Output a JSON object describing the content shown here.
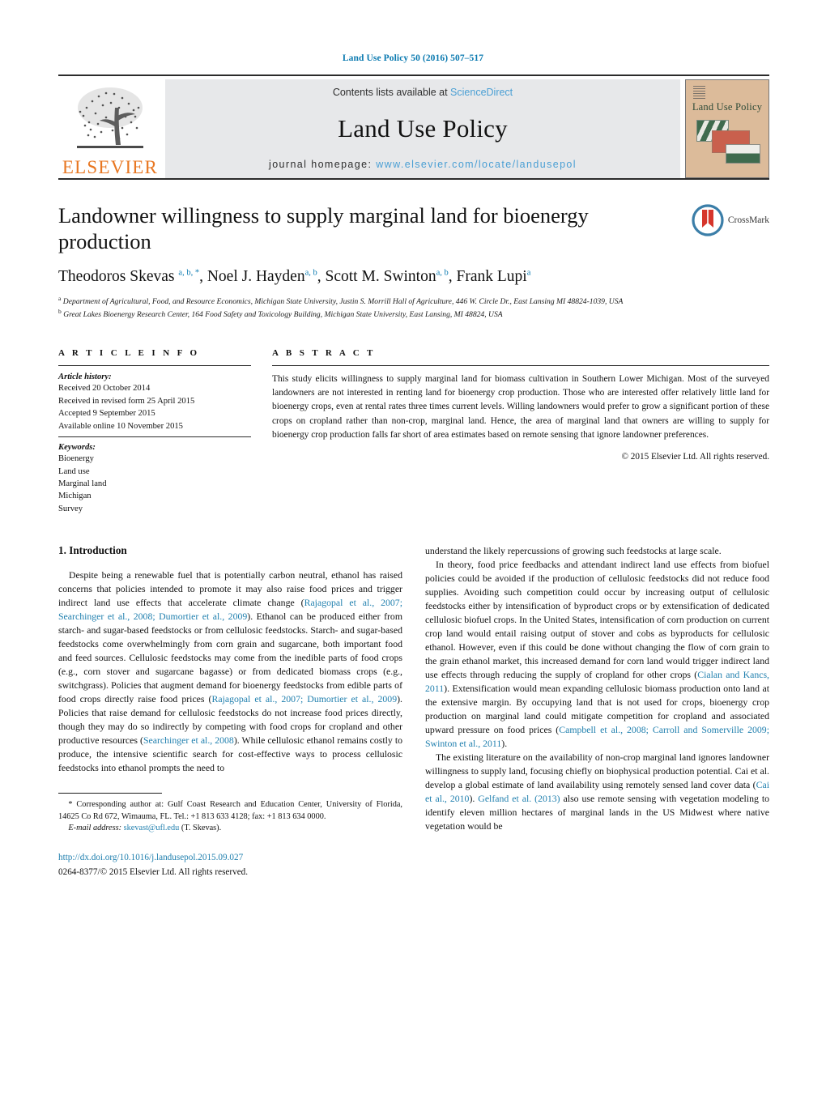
{
  "running_head": "Land Use Policy 50 (2016) 507–517",
  "masthead": {
    "publisher_name": "ELSEVIER",
    "contents_prefix": "Contents lists available at ",
    "contents_link": "ScienceDirect",
    "journal_title": "Land Use Policy",
    "homepage_prefix": "journal homepage: ",
    "homepage_url": "www.elsevier.com/locate/landusepol",
    "cover_title": "Land Use Policy"
  },
  "article": {
    "title": "Landowner willingness to supply marginal land for bioenergy production",
    "authors_html": "Theodoros Skevas <sup>a, b, *</sup>, Noel J. Hayden<sup>a, b</sup>, Scott M. Swinton<sup>a, b</sup>, Frank Lupi<sup>a</sup>",
    "affiliation_a": "Department of Agricultural, Food, and Resource Economics, Michigan State University, Justin S. Morrill Hall of Agriculture, 446 W. Circle Dr., East Lansing MI 48824-1039, USA",
    "affiliation_b": "Great Lakes Bioenergy Research Center, 164 Food Safety and Toxicology Building, Michigan State University, East Lansing, MI 48824, USA",
    "crossmark_label": "CrossMark"
  },
  "info": {
    "heading": "A R T I C L E   I N F O",
    "history_label": "Article history:",
    "history": [
      "Received 20 October 2014",
      "Received in revised form 25 April 2015",
      "Accepted 9 September 2015",
      "Available online 10 November 2015"
    ],
    "keywords_label": "Keywords:",
    "keywords": [
      "Bioenergy",
      "Land use",
      "Marginal land",
      "Michigan",
      "Survey"
    ]
  },
  "abstract": {
    "heading": "A B S T R A C T",
    "text": "This study elicits willingness to supply marginal land for biomass cultivation in Southern Lower Michigan. Most of the surveyed landowners are not interested in renting land for bioenergy crop production. Those who are interested offer relatively little land for bioenergy crops, even at rental rates three times current levels. Willing landowners would prefer to grow a significant portion of these crops on cropland rather than non-crop, marginal land. Hence, the area of marginal land that owners are willing to supply for bioenergy crop production falls far short of area estimates based on remote sensing that ignore landowner preferences.",
    "copyright": "© 2015 Elsevier Ltd. All rights reserved."
  },
  "body": {
    "section_title": "1. Introduction",
    "left_paragraph_1_html": "Despite being a renewable fuel that is potentially carbon neutral, ethanol has raised concerns that policies intended to promote it may also raise food prices and trigger indirect land use effects that accelerate climate change (<span class=\"ref\">Rajagopal et al., 2007; Searchinger et al., 2008; Dumortier et al., 2009</span>). Ethanol can be produced either from starch- and sugar-based feedstocks or from cellulosic feedstocks. Starch- and sugar-based feedstocks come overwhelmingly from corn grain and sugarcane, both important food and feed sources. Cellulosic feedstocks may come from the inedible parts of food crops (e.g., corn stover and sugarcane bagasse) or from dedicated biomass crops (e.g., switchgrass). Policies that augment demand for bioenergy feedstocks from edible parts of food crops directly raise food prices (<span class=\"ref\">Rajagopal et al., 2007; Dumortier et al., 2009</span>). Policies that raise demand for cellulosic feedstocks do not increase food prices directly, though they may do so indirectly by competing with food crops for cropland and other productive resources (<span class=\"ref\">Searchinger et al., 2008</span>). While cellulosic ethanol remains costly to produce, the intensive scientific search for cost-effective ways to process cellulosic feedstocks into ethanol prompts the need to",
    "right_paragraph_1": "understand the likely repercussions of growing such feedstocks at large scale.",
    "right_paragraph_2_html": "In theory, food price feedbacks and attendant indirect land use effects from biofuel policies could be avoided if the production of cellulosic feedstocks did not reduce food supplies. Avoiding such competition could occur by increasing output of cellulosic feedstocks either by intensification of byproduct crops or by extensification of dedicated cellulosic biofuel crops. In the United States, intensification of corn production on current crop land would entail raising output of stover and cobs as byproducts for cellulosic ethanol. However, even if this could be done without changing the flow of corn grain to the grain ethanol market, this increased demand for corn land would trigger indirect land use effects through reducing the supply of cropland for other crops (<span class=\"ref\">Cialan and Kancs, 2011</span>). Extensification would mean expanding cellulosic biomass production onto land at the extensive margin. By occupying land that is not used for crops, bioenergy crop production on marginal land could mitigate competition for cropland and associated upward pressure on food prices (<span class=\"ref\">Campbell et al., 2008; Carroll and Somerville 2009; Swinton et al., 2011</span>).",
    "right_paragraph_3_html": "The existing literature on the availability of non-crop marginal land ignores landowner willingness to supply land, focusing chiefly on biophysical production potential. Cai et al. develop a global estimate of land availability using remotely sensed land cover data (<span class=\"ref\">Cai et al., 2010</span>). <span class=\"ref\">Gelfand et al. (2013)</span> also use remote sensing with vegetation modeling to identify eleven million hectares of marginal lands in the US Midwest where native vegetation would be"
  },
  "footer": {
    "corresponding_html": "* Corresponding author at: Gulf Coast Research and Education Center, University of Florida, 14625 Co Rd 672, Wimauma, FL. Tel.: +1 813 633 4128; fax: +1 813 634 0000.",
    "email_label": "E-mail address:",
    "email": "skevast@ufl.edu",
    "email_suffix": "(T. Skevas).",
    "doi": "http://dx.doi.org/10.1016/j.landusepol.2015.09.027",
    "issn": "0264-8377/© 2015 Elsevier Ltd. All rights reserved."
  },
  "colors": {
    "link_blue": "#1f7fae",
    "header_blue": "#0b7ab0",
    "sciencedirect_blue": "#4a9fd4",
    "elsevier_orange": "#e87722",
    "banner_gray": "#e7e8ea",
    "cover_tan": "#dcbb9a",
    "cover_green": "#2d4a37"
  }
}
